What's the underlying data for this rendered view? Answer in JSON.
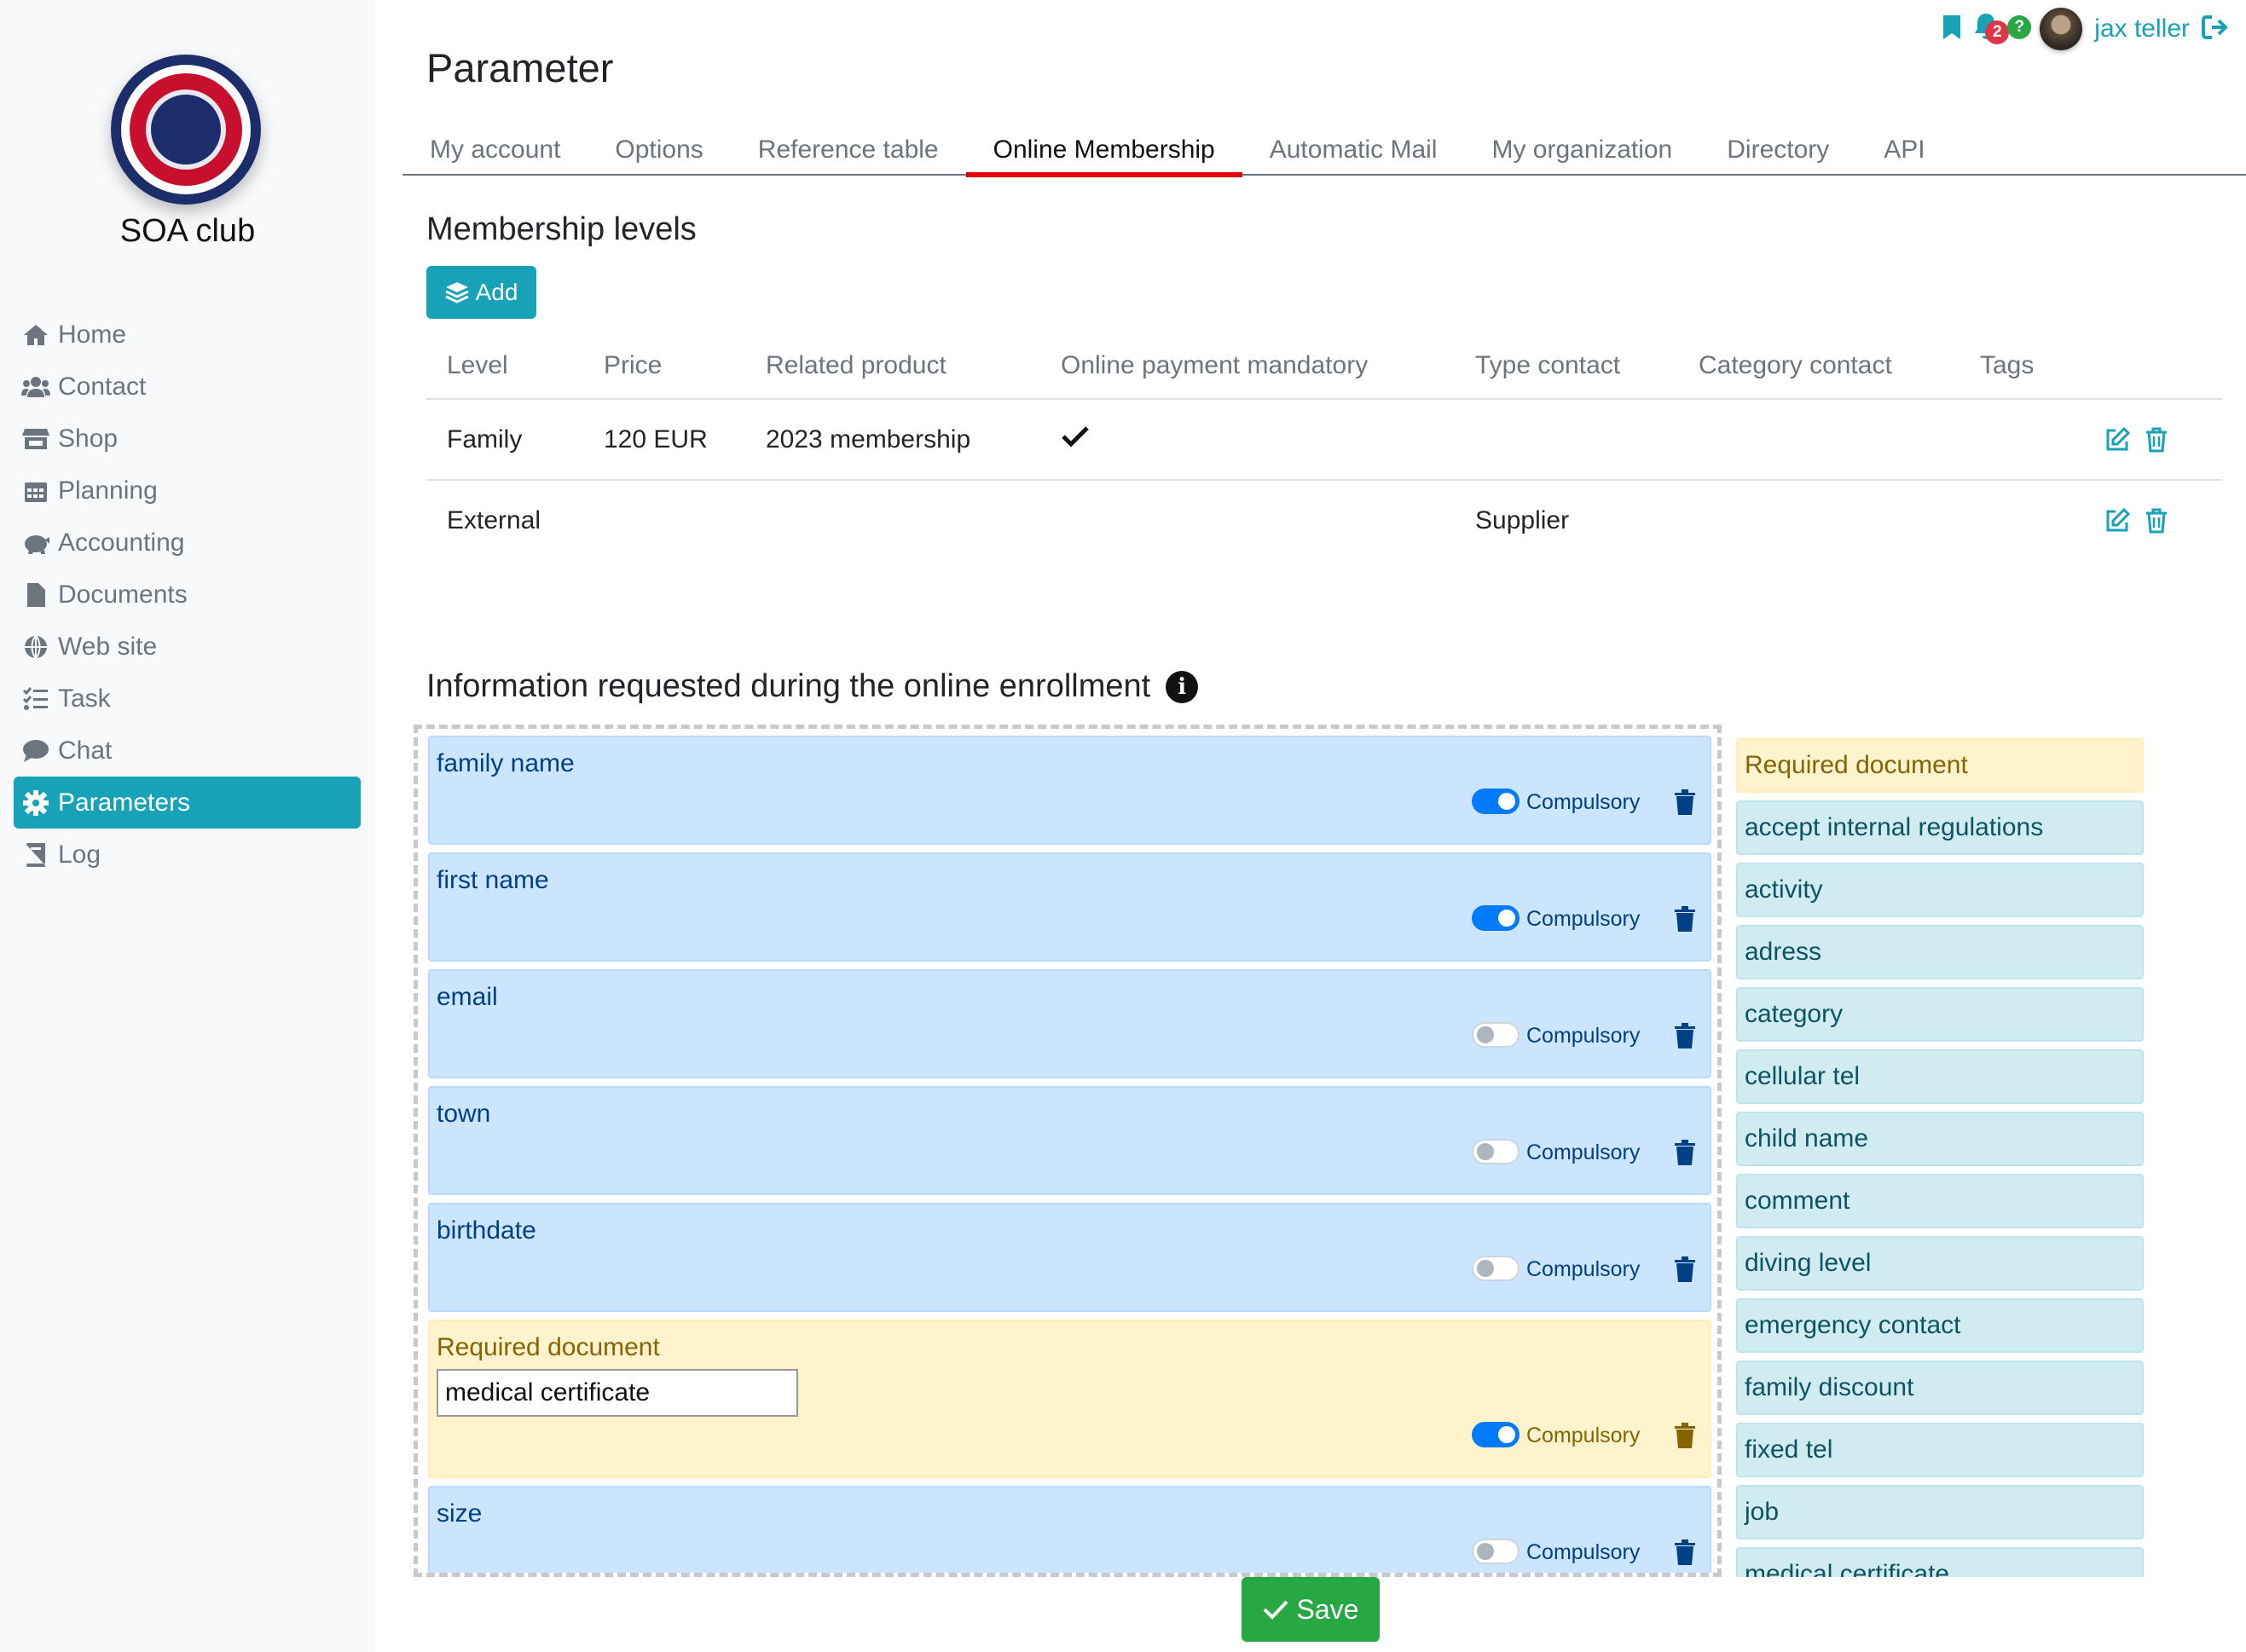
{
  "club": {
    "name": "SOA club"
  },
  "nav": [
    {
      "label": "Home",
      "icon": "home-icon"
    },
    {
      "label": "Contact",
      "icon": "users-icon"
    },
    {
      "label": "Shop",
      "icon": "store-icon"
    },
    {
      "label": "Planning",
      "icon": "calendar-icon"
    },
    {
      "label": "Accounting",
      "icon": "piggy-bank-icon"
    },
    {
      "label": "Documents",
      "icon": "file-icon"
    },
    {
      "label": "Web site",
      "icon": "globe-icon"
    },
    {
      "label": "Task",
      "icon": "tasks-icon"
    },
    {
      "label": "Chat",
      "icon": "comment-icon"
    },
    {
      "label": "Parameters",
      "icon": "gear-icon",
      "active": true
    },
    {
      "label": "Log",
      "icon": "book-icon"
    }
  ],
  "header": {
    "title": "Parameter",
    "notifications_count": "2",
    "help_badge": "?",
    "user_name": "jax teller"
  },
  "tabs": [
    "My account",
    "Options",
    "Reference table",
    "Online Membership",
    "Automatic Mail",
    "My organization",
    "Directory",
    "API"
  ],
  "active_tab": "Online Membership",
  "membership": {
    "title": "Membership levels",
    "add_label": "Add",
    "columns": [
      "Level",
      "Price",
      "Related product",
      "Online payment mandatory",
      "Type contact",
      "Category contact",
      "Tags"
    ],
    "rows": [
      {
        "level": "Family",
        "price": "120 EUR",
        "product": "2023 membership",
        "payment_mandatory": true,
        "type_contact": "",
        "category_contact": "",
        "tags": ""
      },
      {
        "level": "External",
        "price": "",
        "product": "",
        "payment_mandatory": false,
        "type_contact": "Supplier",
        "category_contact": "",
        "tags": ""
      }
    ]
  },
  "enrollment": {
    "title": "Information requested during the online enrollment",
    "compulsory_label": "Compulsory",
    "fields": [
      {
        "name": "family name",
        "compulsory": true,
        "kind": "field"
      },
      {
        "name": "first name",
        "compulsory": true,
        "kind": "field"
      },
      {
        "name": "email",
        "compulsory": false,
        "kind": "field"
      },
      {
        "name": "town",
        "compulsory": false,
        "kind": "field"
      },
      {
        "name": "birthdate",
        "compulsory": false,
        "kind": "field"
      },
      {
        "name": "Required document",
        "value": "medical certificate",
        "compulsory": true,
        "kind": "document"
      },
      {
        "name": "size",
        "compulsory": false,
        "kind": "field"
      }
    ],
    "available": [
      "Required document",
      "accept internal regulations",
      "activity",
      "adress",
      "category",
      "cellular tel",
      "child name",
      "comment",
      "diving level",
      "emergency contact",
      "family discount",
      "fixed tel",
      "job",
      "medical certificate"
    ]
  },
  "save_label": "Save",
  "colors": {
    "accent": "#17a2b8",
    "tab_underline": "#e3000b",
    "save": "#28a745",
    "field_bg": "#cce5ff",
    "doc_bg": "#fff3cd",
    "tag_bg": "#d1ecf1"
  }
}
